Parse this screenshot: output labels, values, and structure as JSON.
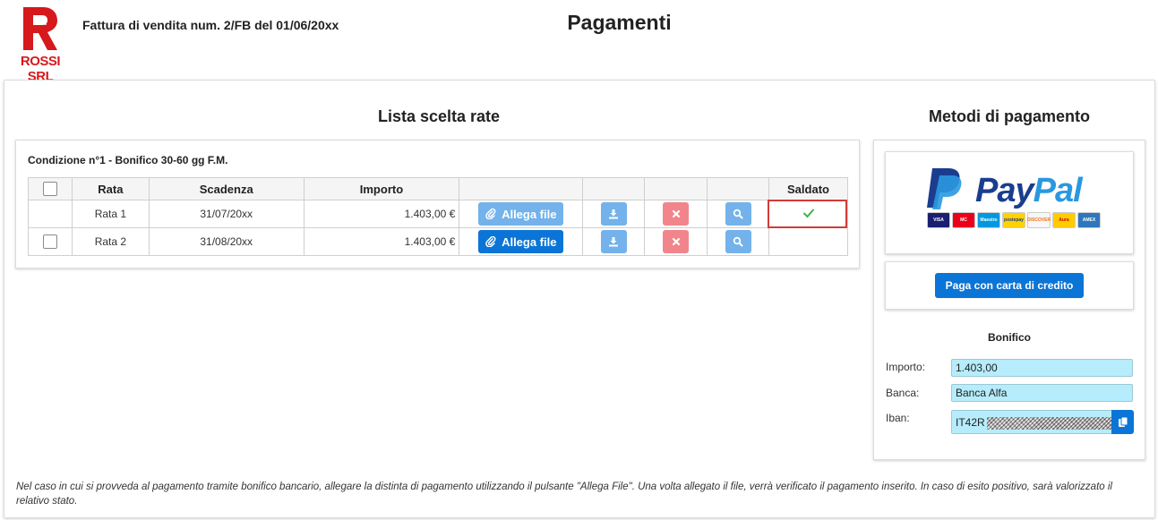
{
  "brand": {
    "name": "ROSSI SRL",
    "color": "#d6191c"
  },
  "header": {
    "invoice_title": "Fattura di vendita num. 2/FB del 01/06/20xx",
    "page_title": "Pagamenti"
  },
  "rate_section": {
    "title": "Lista scelta rate",
    "condition": "Condizione n°1 - Bonifico 30-60 gg F.M.",
    "columns": [
      "Rata",
      "Scadenza",
      "Importo",
      "Saldato"
    ],
    "rows": [
      {
        "rata": "Rata 1",
        "scadenza": "31/07/20xx",
        "importo": "1.403,00 €",
        "allega_label": "Allega file",
        "saldato": true,
        "selectable": false
      },
      {
        "rata": "Rata 2",
        "scadenza": "31/08/20xx",
        "importo": "1.403,00 €",
        "allega_label": "Allega file",
        "saldato": false,
        "selectable": true
      }
    ]
  },
  "metodi": {
    "title": "Metodi di pagamento",
    "paypal": {
      "word_pay": "Pay",
      "word_pal": "Pal",
      "cards": [
        "VISA",
        "MC",
        "Maestro",
        "postepay",
        "DISCOVER",
        "Aura",
        "AMEX"
      ]
    },
    "credit_button": "Paga con carta di credito",
    "bonifico": {
      "title": "Bonifico",
      "importo_label": "Importo:",
      "importo_value": "1.403,00",
      "banca_label": "Banca:",
      "banca_value": "Banca Alfa",
      "iban_label": "Iban:",
      "iban_prefix": "IT42R"
    }
  },
  "footer_note": "Nel caso in cui si provveda al pagamento tramite bonifico bancario, allegare la distinta di pagamento utilizzando il pulsante \"Allega File\". Una volta allegato il file, verrà verificato il pagamento inserito. In caso di esito positivo, sarà valorizzato il relativo stato.",
  "colors": {
    "primary": "#0a75d6",
    "primary_disabled": "#73b2ea",
    "danger": "#f1858b",
    "success": "#3cb44b",
    "input_bg": "#b6ecfb"
  }
}
